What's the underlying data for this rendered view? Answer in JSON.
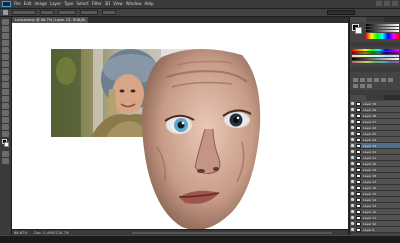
{
  "menubar": {
    "items": [
      "Ps",
      "File",
      "Edit",
      "Image",
      "Layer",
      "Type",
      "Select",
      "Filter",
      "3D",
      "View",
      "Window",
      "Help"
    ]
  },
  "document": {
    "tab_title": "Ladybuddy @ 66.7% (Layer 23, RGB/8)",
    "zoom": "66.67%",
    "status": "Doc: 5.49M/128.7M"
  },
  "layers": {
    "names": [
      "Layer 30",
      "Layer 29",
      "Layer 28",
      "Layer 27",
      "Layer 26",
      "Layer 25",
      "Layer 24",
      "Layer 23",
      "Layer 22",
      "Layer 21",
      "Layer 20",
      "Layer 19",
      "Layer 18",
      "Layer 17",
      "Layer 16",
      "Layer 15",
      "Layer 14",
      "Layer 13",
      "Layer 12",
      "Layer 11",
      "Layer 10",
      "Layer 9"
    ],
    "selected": "Layer 23"
  },
  "colors": {
    "accent": "#4f6f8f",
    "ui_dark": "#3a3a3a",
    "canvas": "#ffffff"
  },
  "icons": [
    "ps-logo-icon",
    "move-tool-icon",
    "marquee-tool-icon",
    "lasso-tool-icon",
    "quick-select-icon",
    "crop-icon",
    "eyedropper-icon",
    "healing-brush-icon",
    "brush-tool-icon",
    "clone-stamp-icon",
    "history-brush-icon",
    "eraser-icon",
    "gradient-icon",
    "blur-icon",
    "dodge-icon",
    "pen-icon",
    "type-icon",
    "path-select-icon",
    "shape-icon",
    "hand-icon",
    "zoom-icon",
    "eye-icon"
  ]
}
